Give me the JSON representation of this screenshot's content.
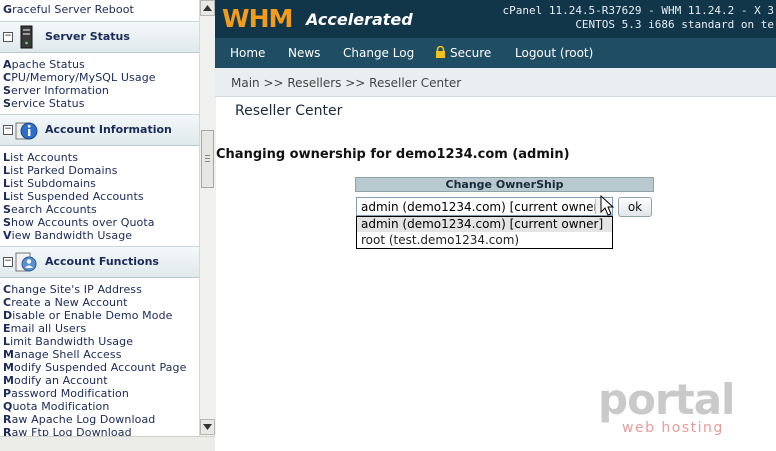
{
  "sidebar": {
    "top_link": "Graceful Server Reboot",
    "groups": [
      {
        "title": "Server Status",
        "icon": "server-icon",
        "items": [
          "Apache Status",
          "CPU/Memory/MySQL Usage",
          "Server Information",
          "Service Status"
        ]
      },
      {
        "title": "Account Information",
        "icon": "info-icon",
        "items": [
          "List Accounts",
          "List Parked Domains",
          "List Subdomains",
          "List Suspended Accounts",
          "Search Accounts",
          "Show Accounts over Quota",
          "View Bandwidth Usage"
        ]
      },
      {
        "title": "Account Functions",
        "icon": "account-functions-icon",
        "items": [
          "Change Site's IP Address",
          "Create a New Account",
          "Disable or Enable Demo Mode",
          "Email all Users",
          "Limit Bandwidth Usage",
          "Manage Shell Access",
          "Modify Suspended Account Page",
          "Modify an Account",
          "Password Modification",
          "Quota Modification",
          "Raw Apache Log Download",
          "Raw Ftp Log Download"
        ]
      }
    ],
    "toggle_symbol": "−"
  },
  "header": {
    "logo_main": "WHM",
    "logo_sub": "Accelerated",
    "version_line1": "cPanel 11.24.5-R37629 - WHM 11.24.2 - X 3",
    "version_line2": "CENTOS 5.3 i686 standard on te"
  },
  "nav": {
    "home": "Home",
    "news": "News",
    "changelog": "Change Log",
    "secure": "Secure",
    "logout": "Logout (root)"
  },
  "breadcrumb": "Main >> Resellers >> Reseller Center",
  "page_title": "Reseller Center",
  "changing_text": "Changing ownership for demo1234.com (admin)",
  "form": {
    "header": "Change OwnerShip",
    "selected_value": "admin (demo1234.com) [current owner]",
    "options": [
      "admin (demo1234.com) [current owner]",
      "root (test.demo1234.com)"
    ],
    "ok_label": "ok"
  },
  "watermark": {
    "main": "portal",
    "sub": "web hosting"
  },
  "colors": {
    "topbar": "#11364a",
    "navbar": "#1f4d63",
    "logo_orange": "#f39c1c",
    "sidebar_link": "#1a2a5a"
  }
}
